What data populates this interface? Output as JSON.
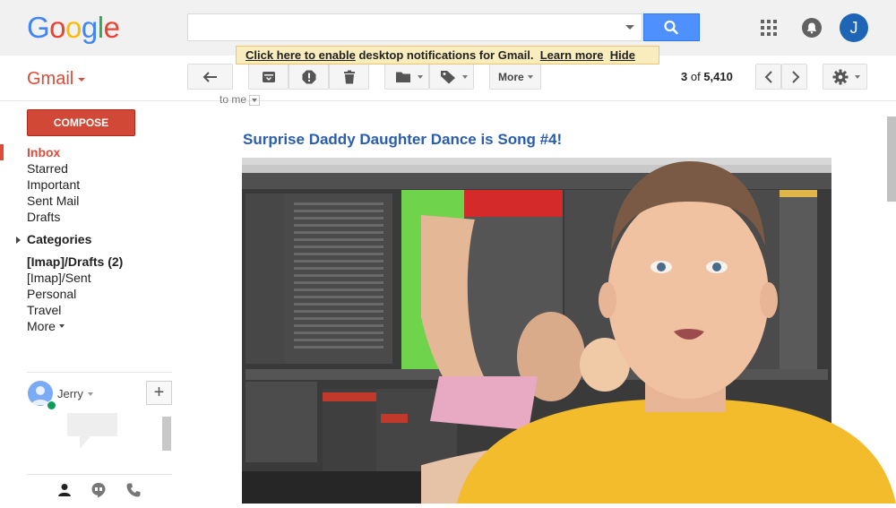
{
  "logo": {
    "letters": [
      "G",
      "o",
      "o",
      "g",
      "l",
      "e"
    ],
    "colors": [
      "#4285f4",
      "#ea4335",
      "#fbbc05",
      "#4285f4",
      "#34a853",
      "#ea4335"
    ]
  },
  "header": {
    "search_placeholder": "",
    "search_icon": "search-icon",
    "apps_icon": "apps-grid-icon",
    "notifications_icon": "notifications-icon",
    "avatar_initial": "J"
  },
  "notification_banner": {
    "enable_link": "Click here to enable",
    "message": " desktop notifications for Gmail.",
    "learn_more": "Learn more",
    "hide": "Hide"
  },
  "gmail_menu": {
    "label": "Gmail"
  },
  "toolbar": {
    "back_icon": "back-arrow-icon",
    "archive_icon": "archive-icon",
    "spam_icon": "report-spam-icon",
    "delete_icon": "trash-icon",
    "move_icon": "folder-icon",
    "labels_icon": "label-icon",
    "more_label": "More",
    "pager_prefix": "3",
    "pager_of": " of ",
    "pager_total": "5,410",
    "settings_icon": "gear-icon"
  },
  "sidebar": {
    "compose_label": "COMPOSE",
    "items": [
      {
        "label": "Inbox"
      },
      {
        "label": "Starred"
      },
      {
        "label": "Important"
      },
      {
        "label": "Sent Mail"
      },
      {
        "label": "Drafts"
      },
      {
        "label": "Categories"
      },
      {
        "label": "[Imap]/Drafts (2)"
      },
      {
        "label": "[Imap]/Sent"
      },
      {
        "label": "Personal"
      },
      {
        "label": "Travel"
      },
      {
        "label": "More"
      }
    ]
  },
  "hangouts": {
    "user_name": "Jerry",
    "add_label": "+"
  },
  "email": {
    "to_me": "to me",
    "subject": "Surprise Daddy Daughter Dance is Song #4!"
  },
  "colors": {
    "accent_red": "#dd4b39",
    "compose_red": "#d14836",
    "link_blue": "#2a5db0",
    "search_blue": "#4d90fe",
    "daw_green": "#6fd34b",
    "daw_red": "#d52a2a",
    "shirt_yellow": "#f2bc2c"
  }
}
